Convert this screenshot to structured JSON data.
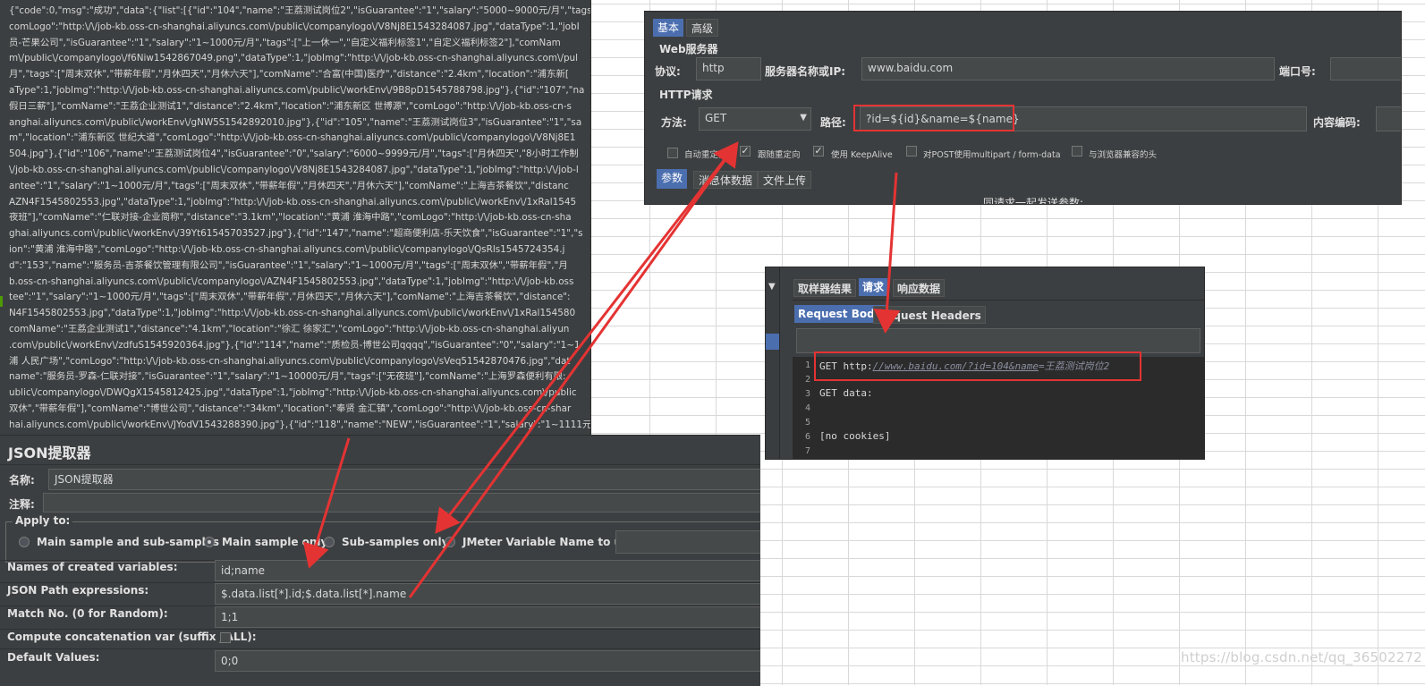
{
  "json_panel": {
    "lines": [
      "{\"code\":0,\"msg\":\"成功\",\"data\":{\"list\":[{\"id\":\"104\",\"name\":\"王荔测试岗位2\",\"isGuarantee\":\"1\",\"salary\":\"5000~9000元/月\",\"tags",
      "comLogo\":\"http:\\/\\/job-kb.oss-cn-shanghai.aliyuncs.com\\/public\\/companylogo\\/V8Nj8E1543284087.jpg\",\"dataType\":1,\"jobI",
      "员-芒果公司\",\"isGuarantee\":\"1\",\"salary\":\"1~1000元/月\",\"tags\":[\"上一休一\",\"自定义福利标签1\",\"自定义福利标签2\"],\"comNam",
      "m\\/public\\/companylogo\\/f6Niw1542867049.png\",\"dataType\":1,\"jobImg\":\"http:\\/\\/job-kb.oss-cn-shanghai.aliyuncs.com\\/pul",
      "月\",\"tags\":[\"周末双休\",\"带薪年假\",\"月休四天\",\"月休六天\"],\"comName\":\"合富(中国)医疗\",\"distance\":\"2.4km\",\"location\":\"浦东新[",
      "aType\":1,\"jobImg\":\"http:\\/\\/job-kb.oss-cn-shanghai.aliyuncs.com\\/public\\/workEnv\\/9B8pD1545788798.jpg\"},{\"id\":\"107\",\"na",
      "假日三薪\"],\"comName\":\"王荔企业测试1\",\"distance\":\"2.4km\",\"location\":\"浦东新区 世博源\",\"comLogo\":\"http:\\/\\/job-kb.oss-cn-s",
      "anghai.aliyuncs.com\\/public\\/workEnv\\/gNW5S1542892010.jpg\"},{\"id\":\"105\",\"name\":\"王荔测试岗位3\",\"isGuarantee\":\"1\",\"sa",
      "m\",\"location\":\"浦东新区 世纪大道\",\"comLogo\":\"http:\\/\\/job-kb.oss-cn-shanghai.aliyuncs.com\\/public\\/companylogo\\/V8Nj8E1",
      "504.jpg\"},{\"id\":\"106\",\"name\":\"王荔测试岗位4\",\"isGuarantee\":\"0\",\"salary\":\"6000~9999元/月\",\"tags\":[\"月休四天\",\"8小时工作制",
      "\\/job-kb.oss-cn-shanghai.aliyuncs.com\\/public\\/companylogo\\/V8Nj8E1543284087.jpg\",\"dataType\":1,\"jobImg\":\"http:\\/\\/job-l",
      "antee\":\"1\",\"salary\":\"1~1000元/月\",\"tags\":[\"周末双休\",\"带薪年假\",\"月休四天\",\"月休六天\"],\"comName\":\"上海吉茶餐饮\",\"distanc",
      "AZN4F1545802553.jpg\",\"dataType\":1,\"jobImg\":\"http:\\/\\/job-kb.oss-cn-shanghai.aliyuncs.com\\/public\\/workEnv\\/1xRal1545",
      "夜班\"],\"comName\":\"仁联对接-企业简称\",\"distance\":\"3.1km\",\"location\":\"黄浦 淮海中路\",\"comLogo\":\"http:\\/\\/job-kb.oss-cn-sha",
      "ghai.aliyuncs.com\\/public\\/workEnv\\/39Yt61545703527.jpg\"},{\"id\":\"147\",\"name\":\"超商便利店-乐天饮食\",\"isGuarantee\":\"1\",\"s",
      "ion\":\"黄浦 淮海中路\",\"comLogo\":\"http:\\/\\/job-kb.oss-cn-shanghai.aliyuncs.com\\/public\\/companylogo\\/QsRls1545724354.j",
      "d\":\"153\",\"name\":\"服务员-吉茶餐饮管理有限公司\",\"isGuarantee\":\"1\",\"salary\":\"1~1000元/月\",\"tags\":[\"周末双休\",\"带薪年假\",\"月",
      "b.oss-cn-shanghai.aliyuncs.com\\/public\\/companylogo\\/AZN4F1545802553.jpg\",\"dataType\":1,\"jobImg\":\"http:\\/\\/job-kb.oss",
      "tee\":\"1\",\"salary\":\"1~1000元/月\",\"tags\":[\"周末双休\",\"带薪年假\",\"月休四天\",\"月休六天\"],\"comName\":\"上海吉茶餐饮\",\"distance\":",
      "N4F1545802553.jpg\",\"dataType\":1,\"jobImg\":\"http:\\/\\/job-kb.oss-cn-shanghai.aliyuncs.com\\/public\\/workEnv\\/1xRal154580",
      "comName\":\"王荔企业测试1\",\"distance\":\"4.1km\",\"location\":\"徐汇 徐家汇\",\"comLogo\":\"http:\\/\\/job-kb.oss-cn-shanghai.aliyun",
      ".com\\/public\\/workEnv\\/zdfuS1545920364.jpg\"},{\"id\":\"114\",\"name\":\"质检员-博世公司qqqq\",\"isGuarantee\":\"0\",\"salary\":\"1~1",
      "浦 人民广场\",\"comLogo\":\"http:\\/\\/job-kb.oss-cn-shanghai.aliyuncs.com\\/public\\/companylogo\\/sVeq51542870476.jpg\",\"dat",
      "name\":\"服务员-罗森-仁联对接\",\"isGuarantee\":\"1\",\"salary\":\"1~10000元/月\",\"tags\":[\"无夜班\"],\"comName\":\"上海罗森便利有限:",
      "ublic\\/companylogo\\/DWQgX1545812425.jpg\",\"dataType\":1,\"jobImg\":\"http:\\/\\/job-kb.oss-cn-shanghai.aliyuncs.com\\/public",
      "双休\",\"带薪年假\"],\"comName\":\"博世公司\",\"distance\":\"34km\",\"location\":\"奉贤 金汇镇\",\"comLogo\":\"http:\\/\\/job-kb.oss-cn-shar",
      "hai.aliyuncs.com\\/public\\/workEnv\\/JYodV1543288390.jpg\"},{\"id\":\"118\",\"name\":\"NEW\",\"isGuarantee\":\"1\",\"salary\":\"1~1111元"
    ]
  },
  "extractor": {
    "title": "JSON提取器",
    "name_label": "名称:",
    "name_value": "JSON提取器",
    "comment_label": "注释:",
    "apply_legend": "Apply to:",
    "apply_options": [
      {
        "label": "Main sample and sub-samples",
        "selected": false
      },
      {
        "label": "Main sample only",
        "selected": true
      },
      {
        "label": "Sub-samples only",
        "selected": false
      },
      {
        "label": "JMeter Variable Name to use",
        "selected": false
      }
    ],
    "fields": [
      {
        "label": "Names of created variables:",
        "value": "id;name"
      },
      {
        "label": "JSON Path expressions:",
        "value": "$.data.list[*].id;$.data.list[*].name"
      },
      {
        "label": "Match No. (0 for Random):",
        "value": "1;1"
      },
      {
        "label": "Compute concatenation var (suffix _ALL):",
        "value": ""
      },
      {
        "label": "Default Values:",
        "value": "0;0"
      }
    ],
    "compute_concat_checked": false
  },
  "http_panel": {
    "tabs": [
      {
        "label": "基本",
        "active": true
      },
      {
        "label": "高级",
        "active": false
      }
    ],
    "web_server_legend": "Web服务器",
    "protocol_label": "协议:",
    "protocol_value": "http",
    "server_label": "服务器名称或IP:",
    "server_value": "www.baidu.com",
    "port_label": "端口号:",
    "port_value": "",
    "http_request_legend": "HTTP请求",
    "method_label": "方法:",
    "method_value": "GET",
    "path_label": "路径:",
    "path_value": "?id=${id}&name=${name}",
    "encoding_label": "内容编码:",
    "checkboxes": [
      {
        "label": "自动重定向",
        "checked": false
      },
      {
        "label": "跟随重定向",
        "checked": true
      },
      {
        "label": "使用 KeepAlive",
        "checked": true
      },
      {
        "label": "对POST使用multipart / form-data",
        "checked": false
      },
      {
        "label": "与浏览器兼容的头",
        "checked": false
      }
    ],
    "sub_tabs": [
      {
        "label": "参数",
        "active": true
      },
      {
        "label": "消息体数据",
        "active": false
      },
      {
        "label": "文件上传",
        "active": false
      }
    ],
    "params_caption": "同请求一起发送参数:"
  },
  "result_panel": {
    "tabs": [
      {
        "label": "取样器结果",
        "active": false
      },
      {
        "label": "请求",
        "active": true
      },
      {
        "label": "响应数据",
        "active": false
      }
    ],
    "sub_tabs": [
      {
        "label": "Request Body",
        "active": true
      },
      {
        "label": "Request Headers",
        "active": false
      }
    ],
    "code_lines": [
      {
        "num": "1",
        "prefix": "GET http:",
        "url": "//www.baidu.com/?id=104&name",
        "suffix": "=王荔测试岗位2"
      },
      {
        "num": "2",
        "text": ""
      },
      {
        "num": "3",
        "text": "GET data:"
      },
      {
        "num": "4",
        "text": ""
      },
      {
        "num": "5",
        "text": ""
      },
      {
        "num": "6",
        "text": "[no cookies]"
      },
      {
        "num": "7",
        "text": ""
      }
    ]
  },
  "watermark": "https://blog.csdn.net/qq_36502272",
  "colors": {
    "panel_bg": "#3c3f41",
    "tab_active": "#4b6eaf",
    "annotation_red": "#e43333"
  }
}
